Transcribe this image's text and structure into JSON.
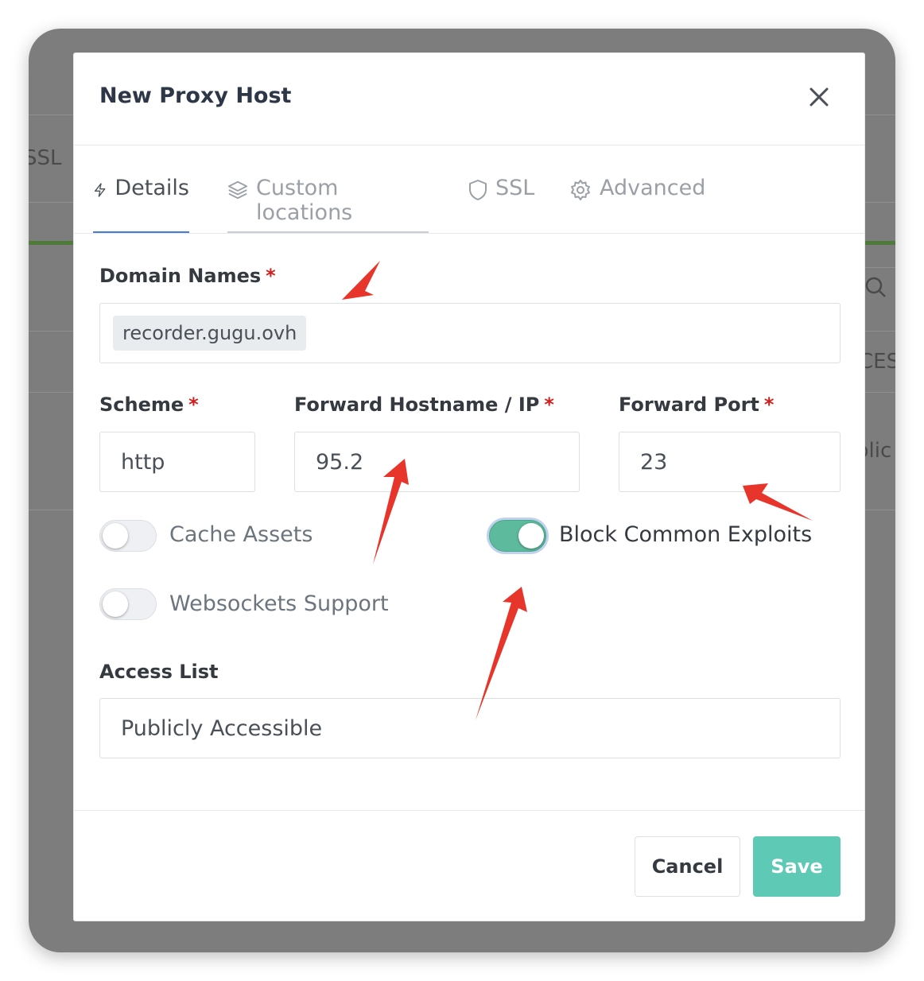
{
  "background": {
    "ssl_fragment": "SSL",
    "ces_fragment": "CES",
    "plic_fragment": "plic"
  },
  "modal": {
    "title": "New Proxy Host",
    "close_icon": "close-icon",
    "tabs": [
      {
        "label": "Details",
        "icon": "bolt-icon",
        "active": true
      },
      {
        "label": "Custom locations",
        "icon": "layers-icon",
        "active": false
      },
      {
        "label": "SSL",
        "icon": "shield-icon",
        "active": false
      },
      {
        "label": "Advanced",
        "icon": "gear-icon",
        "active": false
      }
    ],
    "domain_names": {
      "label": "Domain Names",
      "required_mark": "*",
      "chips": [
        "recorder.gugu.ovh"
      ]
    },
    "scheme": {
      "label": "Scheme",
      "required_mark": "*",
      "value": "http"
    },
    "forward_host": {
      "label": "Forward Hostname / IP",
      "required_mark": "*",
      "value": "95.2"
    },
    "forward_port": {
      "label": "Forward Port",
      "required_mark": "*",
      "value": "23"
    },
    "toggles": {
      "cache_assets": {
        "label": "Cache Assets",
        "on": false
      },
      "block_exploits": {
        "label": "Block Common Exploits",
        "on": true
      },
      "websockets": {
        "label": "Websockets Support",
        "on": false
      }
    },
    "access_list": {
      "label": "Access List",
      "value": "Publicly Accessible"
    },
    "buttons": {
      "cancel": "Cancel",
      "save": "Save"
    }
  },
  "colors": {
    "accent": "#467fcf",
    "save": "#5ec9b5",
    "toggle_on": "#5eba9c",
    "required": "#cd201f",
    "annotation_arrow": "#e8352b"
  }
}
